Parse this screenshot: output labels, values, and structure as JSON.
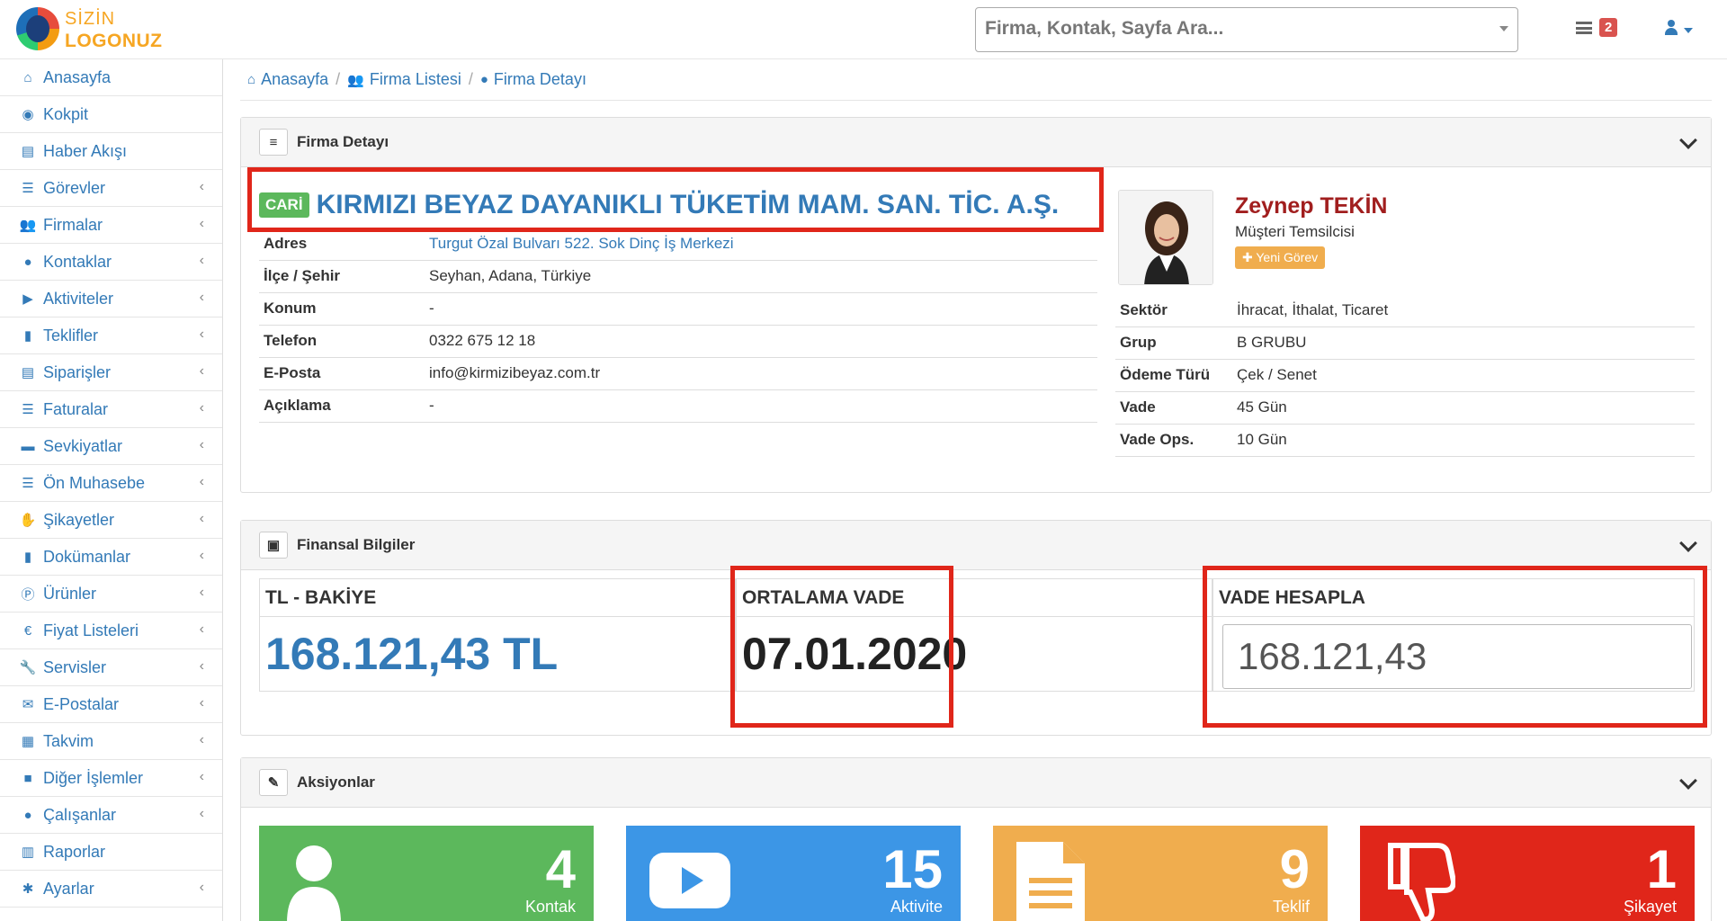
{
  "logo": {
    "line1": "SİZİN",
    "line2": "LOGONUZ"
  },
  "search": {
    "placeholder": "Firma, Kontak, Sayfa Ara..."
  },
  "notifications": {
    "count": "2"
  },
  "sidebar": {
    "items": [
      {
        "label": "Anasayfa",
        "icon": "home-icon",
        "glyph": "⌂",
        "has_children": false
      },
      {
        "label": "Kokpit",
        "icon": "dashboard-icon",
        "glyph": "◉",
        "has_children": false
      },
      {
        "label": "Haber Akışı",
        "icon": "newspaper-icon",
        "glyph": "▤",
        "has_children": false
      },
      {
        "label": "Görevler",
        "icon": "tasks-icon",
        "glyph": "☰",
        "has_children": true
      },
      {
        "label": "Firmalar",
        "icon": "users-icon",
        "glyph": "👥",
        "has_children": true
      },
      {
        "label": "Kontaklar",
        "icon": "user-icon",
        "glyph": "●",
        "has_children": true
      },
      {
        "label": "Aktiviteler",
        "icon": "youtube-icon",
        "glyph": "▶",
        "has_children": true
      },
      {
        "label": "Teklifler",
        "icon": "file-icon",
        "glyph": "▮",
        "has_children": true
      },
      {
        "label": "Siparişler",
        "icon": "list-alt-icon",
        "glyph": "▤",
        "has_children": true
      },
      {
        "label": "Faturalar",
        "icon": "list-icon",
        "glyph": "☰",
        "has_children": true
      },
      {
        "label": "Sevkiyatlar",
        "icon": "truck-icon",
        "glyph": "▬",
        "has_children": true
      },
      {
        "label": "Ön Muhasebe",
        "icon": "list-icon",
        "glyph": "☰",
        "has_children": true
      },
      {
        "label": "Şikayetler",
        "icon": "thumbs-down-icon",
        "glyph": "✋",
        "has_children": true
      },
      {
        "label": "Dokümanlar",
        "icon": "file-icon",
        "glyph": "▮",
        "has_children": true
      },
      {
        "label": "Ürünler",
        "icon": "product-hunt-icon",
        "glyph": "Ⓟ",
        "has_children": true
      },
      {
        "label": "Fiyat Listeleri",
        "icon": "euro-icon",
        "glyph": "€",
        "has_children": true
      },
      {
        "label": "Servisler",
        "icon": "wrench-icon",
        "glyph": "🔧",
        "has_children": true
      },
      {
        "label": "E-Postalar",
        "icon": "envelope-icon",
        "glyph": "✉",
        "has_children": true
      },
      {
        "label": "Takvim",
        "icon": "calendar-icon",
        "glyph": "▦",
        "has_children": true
      },
      {
        "label": "Diğer İşlemler",
        "icon": "square-icon",
        "glyph": "■",
        "has_children": true
      },
      {
        "label": "Çalışanlar",
        "icon": "user-icon",
        "glyph": "●",
        "has_children": true
      },
      {
        "label": "Raporlar",
        "icon": "bar-chart-icon",
        "glyph": "▥",
        "has_children": false
      },
      {
        "label": "Ayarlar",
        "icon": "gear-icon",
        "glyph": "✱",
        "has_children": true
      }
    ]
  },
  "breadcrumb": {
    "home": "Anasayfa",
    "list": "Firma Listesi",
    "current": "Firma Detayı"
  },
  "firm_panel": {
    "title": "Firma Detayı",
    "badge": "CARİ",
    "firm_name": "KIRMIZI BEYAZ DAYANIKLI TÜKETİM MAM. SAN. TİC. A.Ş.",
    "fields": [
      {
        "key": "Adres",
        "value": "Turgut Özal Bulvarı 522. Sok Dinç İş Merkezi",
        "is_link": true
      },
      {
        "key": "İlçe / Şehir",
        "value": "Seyhan, Adana, Türkiye",
        "is_link": false
      },
      {
        "key": "Konum",
        "value": "-",
        "is_link": false
      },
      {
        "key": "Telefon",
        "value": "0322 675 12 18",
        "is_link": false
      },
      {
        "key": "E-Posta",
        "value": "info@kirmizibeyaz.com.tr",
        "is_link": false
      },
      {
        "key": "Açıklama",
        "value": "-",
        "is_link": false
      }
    ],
    "representative": {
      "name": "Zeynep TEKİN",
      "role": "Müşteri Temsilcisi",
      "button": "Yeni Görev"
    },
    "right_fields": [
      {
        "key": "Sektör",
        "value": "İhracat, İthalat, Ticaret"
      },
      {
        "key": "Grup",
        "value": "B GRUBU"
      },
      {
        "key": "Ödeme Türü",
        "value": "Çek / Senet"
      },
      {
        "key": "Vade",
        "value": "45 Gün"
      },
      {
        "key": "Vade Ops.",
        "value": "10 Gün"
      }
    ]
  },
  "finance_panel": {
    "title": "Finansal Bilgiler",
    "balance_label": "TL - BAKİYE",
    "balance_value": "168.121,43 TL",
    "avg_due_label": "ORTALAMA VADE",
    "avg_due_value": "07.01.2020",
    "calc_label": "VADE HESAPLA",
    "calc_value": "168.121,43"
  },
  "actions_panel": {
    "title": "Aksiyonlar",
    "boxes": [
      {
        "count": "4",
        "label": "Kontak",
        "color": "#5cb85c"
      },
      {
        "count": "15",
        "label": "Aktivite",
        "color": "#3c96e6"
      },
      {
        "count": "9",
        "label": "Teklif",
        "color": "#f0ad4e"
      },
      {
        "count": "1",
        "label": "Şikayet",
        "color": "#e0261a"
      }
    ]
  },
  "colors": {
    "accent": "#337ab7",
    "highlight": "#e0261a",
    "rep_name": "#a11e1e"
  }
}
